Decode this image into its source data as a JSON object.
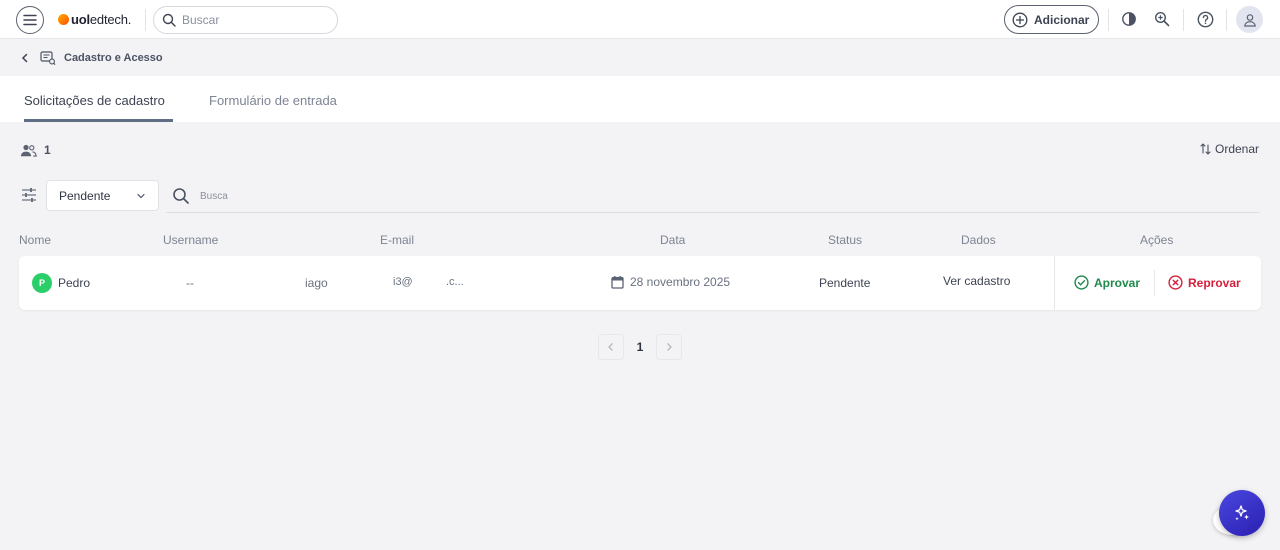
{
  "header": {
    "logo_bold": "uol",
    "logo_text": "edtech.",
    "search_placeholder": "Buscar",
    "add_label": "Adicionar"
  },
  "breadcrumb": {
    "title": "Cadastro e Acesso"
  },
  "tabs": [
    {
      "label": "Solicitações de cadastro",
      "active": true
    },
    {
      "label": "Formulário de entrada",
      "active": false
    }
  ],
  "toolbar": {
    "count": "1",
    "sort_label": "Ordenar",
    "status_filter": "Pendente",
    "search_placeholder": "Busca"
  },
  "table": {
    "columns": [
      "Nome",
      "Username",
      "E-mail",
      "Data",
      "Status",
      "Dados",
      "Ações"
    ],
    "rows": [
      {
        "avatar_initial": "P",
        "name": "Pedro",
        "username": "--",
        "email_part1": "iago",
        "email_part2": "i3@",
        "email_part3": ".c...",
        "date": "28 novembro 2025",
        "status": "Pendente",
        "data_link": "Ver cadastro",
        "approve_label": "Aprovar",
        "reject_label": "Reprovar"
      }
    ]
  },
  "pagination": {
    "current_page": "1"
  },
  "colors": {
    "approve": "#1f8a4c",
    "reject": "#d4203c",
    "avatar": "#2bcf6a",
    "fab": "#3b35d0"
  }
}
